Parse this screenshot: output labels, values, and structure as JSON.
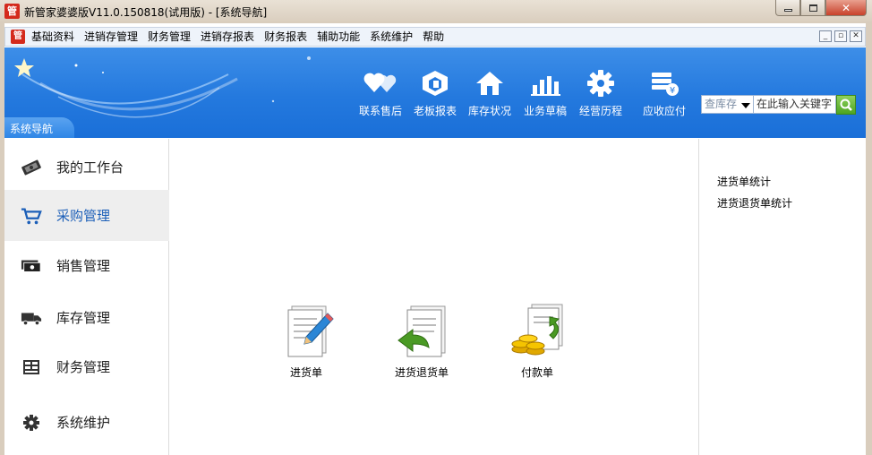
{
  "window": {
    "logo_text": "管",
    "title": "新管家婆婆版V11.0.150818(试用版) - [系统导航]",
    "controls": {
      "minimize": "minimize",
      "maximize": "maximize",
      "close": "close"
    }
  },
  "menubar": {
    "logo_text": "管",
    "items": [
      "基础资料",
      "进销存管理",
      "财务管理",
      "进销存报表",
      "财务报表",
      "辅助功能",
      "系统维护",
      "帮助"
    ]
  },
  "banner": {
    "nav_tab": "系统导航",
    "tools": [
      {
        "label": "联系售后",
        "icon": "hearts-icon"
      },
      {
        "label": "老板报表",
        "icon": "hexagon-report-icon"
      },
      {
        "label": "库存状况",
        "icon": "house-icon"
      },
      {
        "label": "业务草稿",
        "icon": "bar-chart-icon"
      },
      {
        "label": "经营历程",
        "icon": "gear-icon"
      },
      {
        "label": "应收应付",
        "icon": "money-stack-icon"
      }
    ],
    "search": {
      "select_value": "查库存",
      "input_value": "在此输入关键字"
    }
  },
  "sidebar": {
    "items": [
      {
        "label": "我的工作台",
        "icon": "workbench-icon"
      },
      {
        "label": "采购管理",
        "icon": "cart-icon",
        "active": true
      },
      {
        "label": "销售管理",
        "icon": "cash-icon"
      },
      {
        "label": "库存管理",
        "icon": "truck-icon"
      },
      {
        "label": "财务管理",
        "icon": "ledger-icon"
      },
      {
        "label": "系统维护",
        "icon": "gear-icon"
      }
    ]
  },
  "main": {
    "documents": [
      {
        "label": "进货单",
        "icon": "document-pencil-icon"
      },
      {
        "label": "进货退货单",
        "icon": "document-return-icon"
      },
      {
        "label": "付款单",
        "icon": "document-coins-icon"
      }
    ]
  },
  "right_panel": {
    "links": [
      "进货单统计",
      "进货退货单统计"
    ]
  },
  "colors": {
    "banner_blue": "#2479de",
    "active_text": "#1c5fb8",
    "close_red": "#c8412b"
  }
}
